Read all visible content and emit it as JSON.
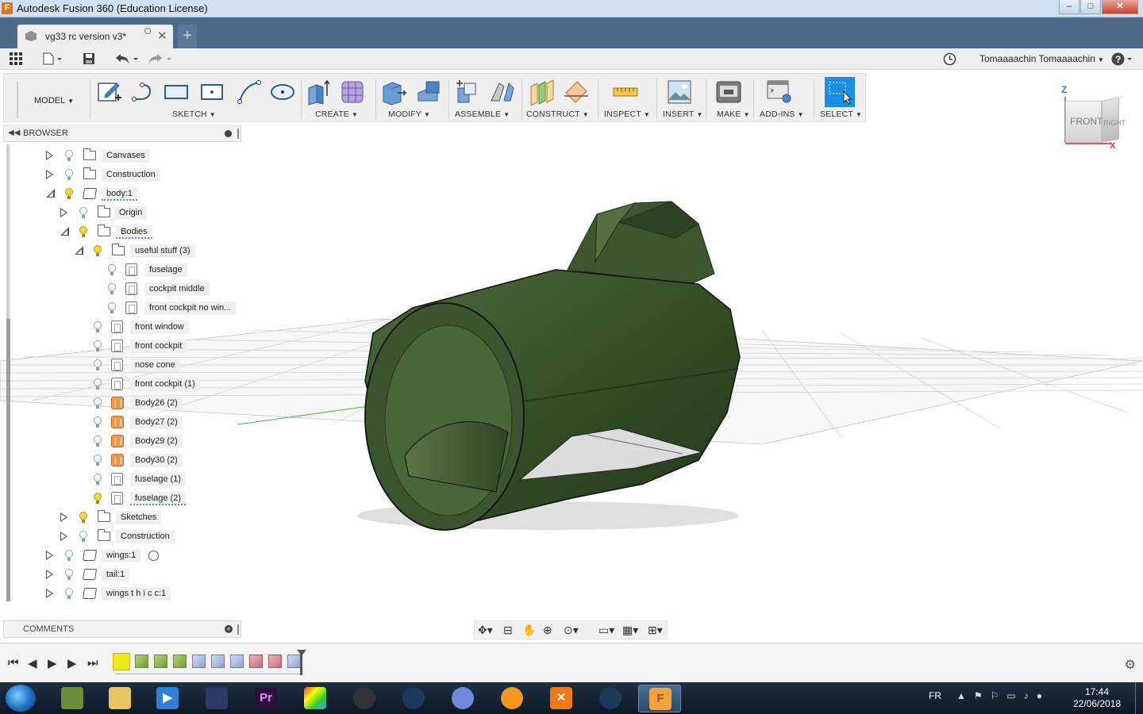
{
  "window": {
    "title": "Autodesk Fusion 360 (Education License)",
    "minimize": "–",
    "maximize": "□",
    "close": "✕"
  },
  "tabs": {
    "doc_title": "vg33 rc version v3*",
    "close": "✕",
    "new": "+"
  },
  "user": {
    "name": "Tomaaaachin Tomaaaachin"
  },
  "toolbar": {
    "workspace": "MODEL",
    "groups": {
      "sketch": "SKETCH",
      "create": "CREATE",
      "modify": "MODIFY",
      "assemble": "ASSEMBLE",
      "construct": "CONSTRUCT",
      "inspect": "INSPECT",
      "insert": "INSERT",
      "make": "MAKE",
      "addins": "ADD-INS",
      "select": "SELECT"
    }
  },
  "viewcube": {
    "front": "FRONT",
    "right": "RIGHT",
    "z": "Z",
    "x": "X"
  },
  "browser": {
    "title": "BROWSER",
    "items": [
      {
        "label": "Canvases",
        "icon": "folder-icon",
        "expanded": false,
        "light": false
      },
      {
        "label": "Construction",
        "icon": "folder-icon",
        "expanded": false,
        "light": false
      },
      {
        "label": "body:1",
        "icon": "component-icon",
        "expanded": true,
        "light": true
      },
      {
        "label": "Origin",
        "icon": "folder-icon",
        "expanded": false,
        "light": false
      },
      {
        "label": "Bodies",
        "icon": "folder-icon",
        "expanded": true,
        "light": true
      },
      {
        "label": "useful stuff (3)",
        "icon": "folder-icon",
        "expanded": true,
        "light": true
      },
      {
        "label": "fuselage",
        "icon": "body-icon",
        "light": false
      },
      {
        "label": "cockpit middle",
        "icon": "body-icon",
        "light": false
      },
      {
        "label": "front cockpit no win...",
        "icon": "body-icon",
        "light": false
      },
      {
        "label": "front window",
        "icon": "body-icon",
        "light": false
      },
      {
        "label": "front cockpit",
        "icon": "body-icon",
        "light": false
      },
      {
        "label": "nose cone",
        "icon": "body-icon",
        "light": false
      },
      {
        "label": "front cockpit (1)",
        "icon": "body-icon",
        "light": false
      },
      {
        "label": "Body26 (2)",
        "icon": "mesh-body-icon",
        "light": false
      },
      {
        "label": "Body27 (2)",
        "icon": "mesh-body-icon",
        "light": false
      },
      {
        "label": "Body29 (2)",
        "icon": "mesh-body-icon",
        "light": false
      },
      {
        "label": "Body30 (2)",
        "icon": "mesh-body-icon",
        "light": false
      },
      {
        "label": "fuselage (1)",
        "icon": "body-icon",
        "light": false
      },
      {
        "label": "fuselage (2)",
        "icon": "body-icon",
        "light": true
      },
      {
        "label": "Sketches",
        "icon": "folder-icon",
        "expanded": false,
        "light": true
      },
      {
        "label": "Construction",
        "icon": "folder-icon",
        "expanded": false,
        "light": false
      },
      {
        "label": "wings:1",
        "icon": "component-icon",
        "expanded": false,
        "light": false
      },
      {
        "label": "tail:1",
        "icon": "component-icon",
        "expanded": false,
        "light": false
      },
      {
        "label": "wings t h i c c:1",
        "icon": "component-icon",
        "expanded": false,
        "light": false
      }
    ]
  },
  "comments": {
    "title": "COMMENTS"
  },
  "taskbar": {
    "language": "FR",
    "time": "17:44",
    "date": "22/06/2018"
  },
  "colors": {
    "model": "#2f4a22",
    "accent": "#1a90e4",
    "titlebar": "#cfe0f3",
    "tabbar": "#4d6a89"
  }
}
